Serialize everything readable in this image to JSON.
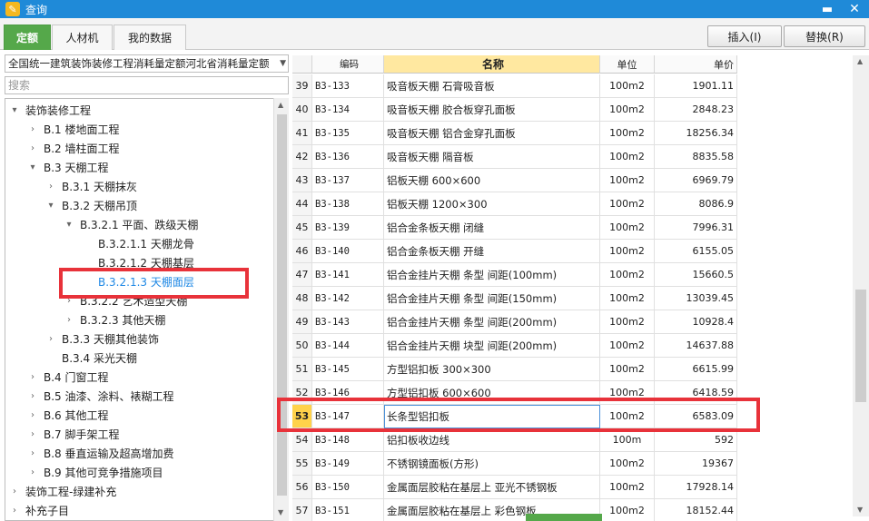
{
  "window": {
    "title": "查询",
    "minimize": "▬",
    "close": "✕",
    "app_icon_glyph": "✎"
  },
  "tabs": [
    {
      "label": "定额",
      "active": true
    },
    {
      "label": "人材机",
      "active": false
    },
    {
      "label": "我的数据",
      "active": false
    }
  ],
  "toolbar": {
    "insert_label": "插入(I)",
    "replace_label": "替换(R)"
  },
  "left_panel": {
    "quota_set": "全国统一建筑装饰装修工程消耗量定额河北省消耗量定额",
    "search_placeholder": "搜索",
    "tree": [
      {
        "label": "装饰装修工程",
        "toggle": "▾",
        "indent": 0
      },
      {
        "label": "B.1 楼地面工程",
        "toggle": "›",
        "indent": 1
      },
      {
        "label": "B.2 墙柱面工程",
        "toggle": "›",
        "indent": 1
      },
      {
        "label": "B.3 天棚工程",
        "toggle": "▾",
        "indent": 1
      },
      {
        "label": "B.3.1 天棚抹灰",
        "toggle": "›",
        "indent": 2
      },
      {
        "label": "B.3.2 天棚吊顶",
        "toggle": "▾",
        "indent": 2
      },
      {
        "label": "B.3.2.1 平面、跌级天棚",
        "toggle": "▾",
        "indent": 3
      },
      {
        "label": "B.3.2.1.1 天棚龙骨",
        "toggle": "",
        "indent": 4
      },
      {
        "label": "B.3.2.1.2 天棚基层",
        "toggle": "",
        "indent": 4
      },
      {
        "label": "B.3.2.1.3 天棚面层",
        "toggle": "",
        "indent": 4,
        "selected": true
      },
      {
        "label": "B.3.2.2 艺术造型天棚",
        "toggle": "›",
        "indent": 3
      },
      {
        "label": "B.3.2.3 其他天棚",
        "toggle": "›",
        "indent": 3
      },
      {
        "label": "B.3.3 天棚其他装饰",
        "toggle": "›",
        "indent": 2
      },
      {
        "label": "B.3.4 采光天棚",
        "toggle": "",
        "indent": 2
      },
      {
        "label": "B.4 门窗工程",
        "toggle": "›",
        "indent": 1
      },
      {
        "label": "B.5 油漆、涂料、裱糊工程",
        "toggle": "›",
        "indent": 1
      },
      {
        "label": "B.6 其他工程",
        "toggle": "›",
        "indent": 1
      },
      {
        "label": "B.7 脚手架工程",
        "toggle": "›",
        "indent": 1
      },
      {
        "label": "B.8 垂直运输及超高增加费",
        "toggle": "›",
        "indent": 1
      },
      {
        "label": "B.9 其他可竞争措施项目",
        "toggle": "›",
        "indent": 1
      },
      {
        "label": "装饰工程-绿建补充",
        "toggle": "›",
        "indent": 0
      },
      {
        "label": "补充子目",
        "toggle": "›",
        "indent": 0
      }
    ]
  },
  "grid": {
    "headers": [
      "",
      "编码",
      "名称",
      "单位",
      "单价"
    ],
    "active_header": 2,
    "rows": [
      {
        "no": "39",
        "code": "B3-133",
        "name": "吸音板天棚 石膏吸音板",
        "unit": "100m2",
        "price": "1901.11"
      },
      {
        "no": "40",
        "code": "B3-134",
        "name": "吸音板天棚 胶合板穿孔面板",
        "unit": "100m2",
        "price": "2848.23"
      },
      {
        "no": "41",
        "code": "B3-135",
        "name": "吸音板天棚 铝合金穿孔面板",
        "unit": "100m2",
        "price": "18256.34"
      },
      {
        "no": "42",
        "code": "B3-136",
        "name": "吸音板天棚 隔音板",
        "unit": "100m2",
        "price": "8835.58"
      },
      {
        "no": "43",
        "code": "B3-137",
        "name": "铝板天棚 600×600",
        "unit": "100m2",
        "price": "6969.79"
      },
      {
        "no": "44",
        "code": "B3-138",
        "name": "铝板天棚 1200×300",
        "unit": "100m2",
        "price": "8086.9"
      },
      {
        "no": "45",
        "code": "B3-139",
        "name": "铝合金条板天棚 闭缝",
        "unit": "100m2",
        "price": "7996.31"
      },
      {
        "no": "46",
        "code": "B3-140",
        "name": "铝合金条板天棚 开缝",
        "unit": "100m2",
        "price": "6155.05"
      },
      {
        "no": "47",
        "code": "B3-141",
        "name": "铝合金挂片天棚 条型 间距(100mm)",
        "unit": "100m2",
        "price": "15660.5"
      },
      {
        "no": "48",
        "code": "B3-142",
        "name": "铝合金挂片天棚 条型 间距(150mm)",
        "unit": "100m2",
        "price": "13039.45"
      },
      {
        "no": "49",
        "code": "B3-143",
        "name": "铝合金挂片天棚 条型 间距(200mm)",
        "unit": "100m2",
        "price": "10928.4"
      },
      {
        "no": "50",
        "code": "B3-144",
        "name": "铝合金挂片天棚 块型 间距(200mm)",
        "unit": "100m2",
        "price": "14637.88"
      },
      {
        "no": "51",
        "code": "B3-145",
        "name": "方型铝扣板 300×300",
        "unit": "100m2",
        "price": "6615.99"
      },
      {
        "no": "52",
        "code": "B3-146",
        "name": "方型铝扣板 600×600",
        "unit": "100m2",
        "price": "6418.59"
      },
      {
        "no": "53",
        "code": "B3-147",
        "name": "长条型铝扣板",
        "unit": "100m2",
        "price": "6583.09",
        "current": true
      },
      {
        "no": "54",
        "code": "B3-148",
        "name": "铝扣板收边线",
        "unit": "100m",
        "price": "592"
      },
      {
        "no": "55",
        "code": "B3-149",
        "name": "不锈钢镜面板(方形)",
        "unit": "100m2",
        "price": "19367"
      },
      {
        "no": "56",
        "code": "B3-150",
        "name": "金属面层胶粘在基层上 亚光不锈钢板",
        "unit": "100m2",
        "price": "17928.14"
      },
      {
        "no": "57",
        "code": "B3-151",
        "name": "金属面层胶粘在基层上 彩色钢板",
        "unit": "100m2",
        "price": "18152.44"
      }
    ]
  },
  "highlights": {
    "color": "#e8323a"
  }
}
